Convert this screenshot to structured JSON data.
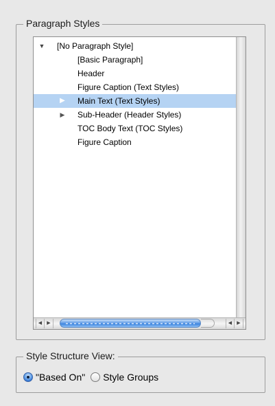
{
  "paragraph_styles": {
    "title": "Paragraph Styles",
    "items": [
      {
        "label": "[No Paragraph Style]",
        "disclosure": "open",
        "selected": false
      },
      {
        "label": "[Basic Paragraph]",
        "disclosure": "none",
        "selected": false
      },
      {
        "label": "Header",
        "disclosure": "none",
        "selected": false
      },
      {
        "label": "Figure Caption (Text Styles)",
        "disclosure": "none",
        "selected": false
      },
      {
        "label": "Main Text (Text Styles)",
        "disclosure": "closed",
        "selected": true
      },
      {
        "label": "Sub-Header (Header Styles)",
        "disclosure": "closed",
        "selected": false
      },
      {
        "label": "TOC Body Text (TOC Styles)",
        "disclosure": "none",
        "selected": false
      },
      {
        "label": "Figure Caption",
        "disclosure": "none",
        "selected": false
      }
    ],
    "disclosure_open_icon": "triangle-down-icon",
    "disclosure_closed_icon": "triangle-right-icon"
  },
  "style_structure_view": {
    "title": "Style Structure View:",
    "options": [
      {
        "label": "\"Based On\"",
        "checked": true
      },
      {
        "label": "Style Groups",
        "checked": false
      }
    ]
  },
  "colors": {
    "selection": "#b5d3f3",
    "window_bg": "#e8e8e8",
    "scroll_thumb": "#3f86e0"
  }
}
